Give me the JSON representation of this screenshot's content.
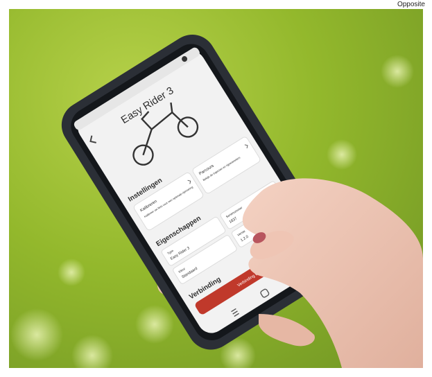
{
  "watermark": "Opposite",
  "app": {
    "title": "Easy Rider 3",
    "settings_heading": "Instellingen",
    "settings_cards": [
      {
        "title": "Kalibreren",
        "desc": "Kalibreer uw fiets voor een optimale rijervaring"
      },
      {
        "title": "Parcours",
        "desc": "Bekijk de trajecten en rijparameters"
      }
    ],
    "properties_heading": "Eigenschappen",
    "properties": [
      {
        "label": "Type",
        "value": "Easy Rider 3"
      },
      {
        "label": "Serienummer",
        "value": "1837"
      },
      {
        "label": "Kleur",
        "value": "Standaard"
      },
      {
        "label": "Versie",
        "value": "1.2.0"
      }
    ],
    "connection_heading": "Verbinding",
    "connect_button": "Verbinding verbreken"
  },
  "colors": {
    "accent": "#c0392b",
    "screen": "#f2f2f2",
    "phone_frame": "#2b2f36"
  }
}
